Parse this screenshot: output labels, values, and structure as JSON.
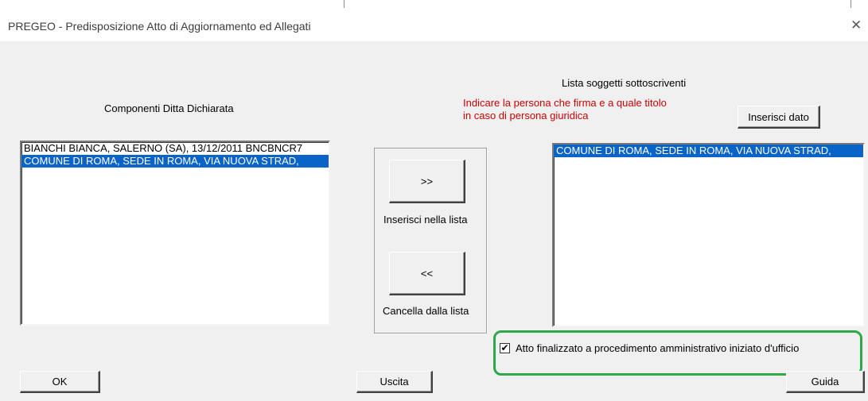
{
  "window": {
    "title": "PREGEO - Predisposizione Atto di Aggiornamento ed Allegati",
    "close_glyph": "✕"
  },
  "left_panel": {
    "heading": "Componenti Ditta Dichiarata",
    "items": [
      {
        "text": "BIANCHI BIANCA, SALERNO (SA), 13/12/2011 BNCBNCR7",
        "selected": false
      },
      {
        "text": "COMUNE DI ROMA, SEDE IN ROMA, VIA NUOVA STRAD,",
        "selected": true
      }
    ]
  },
  "middle": {
    "insert_button": ">>",
    "insert_label": "Inserisci nella lista",
    "remove_button": "<<",
    "remove_label": "Cancella dalla lista"
  },
  "right_panel": {
    "heading": "Lista soggetti sottoscriventi",
    "hint_line1": "Indicare la persona che firma e a quale titolo",
    "hint_line2": "in caso di persona giuridica",
    "insert_data_button": "Inserisci dato",
    "items": [
      {
        "text": "COMUNE DI ROMA, SEDE IN ROMA, VIA NUOVA STRAD,",
        "selected": true
      }
    ]
  },
  "checkbox": {
    "checked": true,
    "check_glyph": "✔",
    "label": "Atto finalizzato a procedimento amministrativo iniziato d'ufficio"
  },
  "footer": {
    "ok": "OK",
    "exit": "Uscita",
    "help": "Guida"
  },
  "colors": {
    "selection": "#0a64c8",
    "hint_text": "#cc0000",
    "highlight_border": "#2ea84a",
    "dialog_bg": "#f0f0f0"
  }
}
